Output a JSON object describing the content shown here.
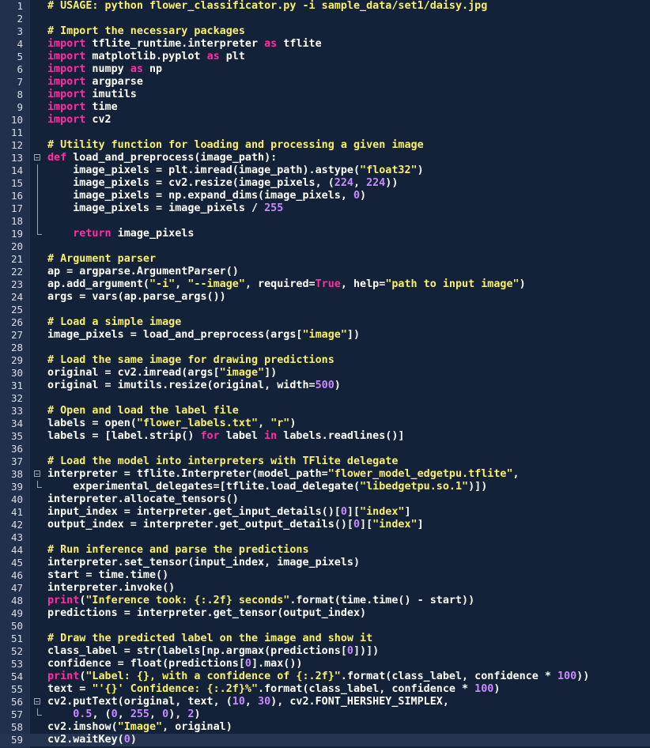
{
  "editor": {
    "colors": {
      "background": "#142239",
      "gutter": "#22314b",
      "current_line": "#25354f",
      "keyword": "#ff2fa3",
      "string": "#f9ef6a",
      "number": "#c78bff",
      "plain": "#ffffff"
    },
    "current_line": 59,
    "lines": [
      {
        "n": "1",
        "fold": "",
        "tokens": [
          {
            "t": "# USAGE: python flower_classificator.py -i sample_data/set1/daisy.jpg",
            "c": "com"
          }
        ]
      },
      {
        "n": "2",
        "fold": "",
        "tokens": []
      },
      {
        "n": "3",
        "fold": "",
        "tokens": [
          {
            "t": "# Import the necessary packages",
            "c": "com"
          }
        ]
      },
      {
        "n": "4",
        "fold": "",
        "tokens": [
          {
            "t": "import",
            "c": "kw"
          },
          {
            "t": " tflite_runtime.interpreter ",
            "c": "plain"
          },
          {
            "t": "as",
            "c": "kw"
          },
          {
            "t": " tflite",
            "c": "plain"
          }
        ]
      },
      {
        "n": "5",
        "fold": "",
        "tokens": [
          {
            "t": "import",
            "c": "kw"
          },
          {
            "t": " matplotlib.pyplot ",
            "c": "plain"
          },
          {
            "t": "as",
            "c": "kw"
          },
          {
            "t": " plt",
            "c": "plain"
          }
        ]
      },
      {
        "n": "6",
        "fold": "",
        "tokens": [
          {
            "t": "import",
            "c": "kw"
          },
          {
            "t": " numpy ",
            "c": "plain"
          },
          {
            "t": "as",
            "c": "kw"
          },
          {
            "t": " np",
            "c": "plain"
          }
        ]
      },
      {
        "n": "7",
        "fold": "",
        "tokens": [
          {
            "t": "import",
            "c": "kw"
          },
          {
            "t": " argparse",
            "c": "plain"
          }
        ]
      },
      {
        "n": "8",
        "fold": "",
        "tokens": [
          {
            "t": "import",
            "c": "kw"
          },
          {
            "t": " imutils",
            "c": "plain"
          }
        ]
      },
      {
        "n": "9",
        "fold": "",
        "tokens": [
          {
            "t": "import",
            "c": "kw"
          },
          {
            "t": " time",
            "c": "plain"
          }
        ]
      },
      {
        "n": "10",
        "fold": "",
        "tokens": [
          {
            "t": "import",
            "c": "kw"
          },
          {
            "t": " cv2",
            "c": "plain"
          }
        ]
      },
      {
        "n": "11",
        "fold": "",
        "tokens": []
      },
      {
        "n": "12",
        "fold": "",
        "tokens": [
          {
            "t": "# Utility function for loading and processing a given image",
            "c": "com"
          }
        ]
      },
      {
        "n": "13",
        "fold": "box",
        "tokens": [
          {
            "t": "def",
            "c": "kw"
          },
          {
            "t": " load_and_preprocess(image_path):",
            "c": "plain"
          }
        ]
      },
      {
        "n": "14",
        "fold": "bar",
        "tokens": [
          {
            "t": "    image_pixels = plt.imread(image_path).astype(",
            "c": "plain"
          },
          {
            "t": "\"float32\"",
            "c": "str"
          },
          {
            "t": ")",
            "c": "plain"
          }
        ]
      },
      {
        "n": "15",
        "fold": "bar",
        "tokens": [
          {
            "t": "    image_pixels = cv2.resize(image_pixels, (",
            "c": "plain"
          },
          {
            "t": "224",
            "c": "num"
          },
          {
            "t": ", ",
            "c": "plain"
          },
          {
            "t": "224",
            "c": "num"
          },
          {
            "t": "))",
            "c": "plain"
          }
        ]
      },
      {
        "n": "16",
        "fold": "bar",
        "tokens": [
          {
            "t": "    image_pixels = np.expand_dims(image_pixels, ",
            "c": "plain"
          },
          {
            "t": "0",
            "c": "num"
          },
          {
            "t": ")",
            "c": "plain"
          }
        ]
      },
      {
        "n": "17",
        "fold": "bar",
        "tokens": [
          {
            "t": "    image_pixels = image_pixels / ",
            "c": "plain"
          },
          {
            "t": "255",
            "c": "num"
          }
        ]
      },
      {
        "n": "18",
        "fold": "bar",
        "tokens": []
      },
      {
        "n": "19",
        "fold": "end",
        "tokens": [
          {
            "t": "    ",
            "c": "plain"
          },
          {
            "t": "return",
            "c": "kw"
          },
          {
            "t": " image_pixels",
            "c": "plain"
          }
        ]
      },
      {
        "n": "20",
        "fold": "",
        "tokens": []
      },
      {
        "n": "21",
        "fold": "",
        "tokens": [
          {
            "t": "# Argument parser",
            "c": "com"
          }
        ]
      },
      {
        "n": "22",
        "fold": "",
        "tokens": [
          {
            "t": "ap = argparse.ArgumentParser()",
            "c": "plain"
          }
        ]
      },
      {
        "n": "23",
        "fold": "",
        "tokens": [
          {
            "t": "ap.add_argument(",
            "c": "plain"
          },
          {
            "t": "\"-i\"",
            "c": "str"
          },
          {
            "t": ", ",
            "c": "plain"
          },
          {
            "t": "\"--image\"",
            "c": "str"
          },
          {
            "t": ", required=",
            "c": "plain"
          },
          {
            "t": "True",
            "c": "const"
          },
          {
            "t": ", help=",
            "c": "plain"
          },
          {
            "t": "\"path to input image\"",
            "c": "str"
          },
          {
            "t": ")",
            "c": "plain"
          }
        ]
      },
      {
        "n": "24",
        "fold": "",
        "tokens": [
          {
            "t": "args = vars(ap.parse_args())",
            "c": "plain"
          }
        ]
      },
      {
        "n": "25",
        "fold": "",
        "tokens": []
      },
      {
        "n": "26",
        "fold": "",
        "tokens": [
          {
            "t": "# Load a simple image",
            "c": "com"
          }
        ]
      },
      {
        "n": "27",
        "fold": "",
        "tokens": [
          {
            "t": "image_pixels = load_and_preprocess(args[",
            "c": "plain"
          },
          {
            "t": "\"image\"",
            "c": "str"
          },
          {
            "t": "])",
            "c": "plain"
          }
        ]
      },
      {
        "n": "28",
        "fold": "",
        "tokens": []
      },
      {
        "n": "29",
        "fold": "",
        "tokens": [
          {
            "t": "# Load the same image for drawing predictions",
            "c": "com"
          }
        ]
      },
      {
        "n": "30",
        "fold": "",
        "tokens": [
          {
            "t": "original = cv2.imread(args[",
            "c": "plain"
          },
          {
            "t": "\"image\"",
            "c": "str"
          },
          {
            "t": "])",
            "c": "plain"
          }
        ]
      },
      {
        "n": "31",
        "fold": "",
        "tokens": [
          {
            "t": "original = imutils.resize(original, width=",
            "c": "plain"
          },
          {
            "t": "500",
            "c": "num"
          },
          {
            "t": ")",
            "c": "plain"
          }
        ]
      },
      {
        "n": "32",
        "fold": "",
        "tokens": []
      },
      {
        "n": "33",
        "fold": "",
        "tokens": [
          {
            "t": "# Open and load the label file",
            "c": "com"
          }
        ]
      },
      {
        "n": "34",
        "fold": "",
        "tokens": [
          {
            "t": "labels = open(",
            "c": "plain"
          },
          {
            "t": "\"flower_labels.txt\"",
            "c": "str"
          },
          {
            "t": ", ",
            "c": "plain"
          },
          {
            "t": "\"r\"",
            "c": "str"
          },
          {
            "t": ")",
            "c": "plain"
          }
        ]
      },
      {
        "n": "35",
        "fold": "",
        "tokens": [
          {
            "t": "labels = [label.strip() ",
            "c": "plain"
          },
          {
            "t": "for",
            "c": "kw"
          },
          {
            "t": " label ",
            "c": "plain"
          },
          {
            "t": "in",
            "c": "kw"
          },
          {
            "t": " labels.readlines()]",
            "c": "plain"
          }
        ]
      },
      {
        "n": "36",
        "fold": "",
        "tokens": []
      },
      {
        "n": "37",
        "fold": "",
        "tokens": [
          {
            "t": "# Load the model into interpreters with TFlite delegate",
            "c": "com"
          }
        ]
      },
      {
        "n": "38",
        "fold": "box",
        "tokens": [
          {
            "t": "interpreter = tflite.Interpreter(model_path=",
            "c": "plain"
          },
          {
            "t": "\"flower_model_edgetpu.tflite\"",
            "c": "str"
          },
          {
            "t": ",",
            "c": "plain"
          }
        ]
      },
      {
        "n": "39",
        "fold": "end",
        "tokens": [
          {
            "t": "    experimental_delegates=[tflite.load_delegate(",
            "c": "plain"
          },
          {
            "t": "\"libedgetpu.so.1\"",
            "c": "str"
          },
          {
            "t": ")])",
            "c": "plain"
          }
        ]
      },
      {
        "n": "40",
        "fold": "",
        "tokens": [
          {
            "t": "interpreter.allocate_tensors()",
            "c": "plain"
          }
        ]
      },
      {
        "n": "41",
        "fold": "",
        "tokens": [
          {
            "t": "input_index = interpreter.get_input_details()[",
            "c": "plain"
          },
          {
            "t": "0",
            "c": "num"
          },
          {
            "t": "][",
            "c": "plain"
          },
          {
            "t": "\"index\"",
            "c": "str"
          },
          {
            "t": "]",
            "c": "plain"
          }
        ]
      },
      {
        "n": "42",
        "fold": "",
        "tokens": [
          {
            "t": "output_index = interpreter.get_output_details()[",
            "c": "plain"
          },
          {
            "t": "0",
            "c": "num"
          },
          {
            "t": "][",
            "c": "plain"
          },
          {
            "t": "\"index\"",
            "c": "str"
          },
          {
            "t": "]",
            "c": "plain"
          }
        ]
      },
      {
        "n": "43",
        "fold": "",
        "tokens": []
      },
      {
        "n": "44",
        "fold": "",
        "tokens": [
          {
            "t": "# Run inference and parse the predictions",
            "c": "com"
          }
        ]
      },
      {
        "n": "45",
        "fold": "",
        "tokens": [
          {
            "t": "interpreter.set_tensor(input_index, image_pixels)",
            "c": "plain"
          }
        ]
      },
      {
        "n": "46",
        "fold": "",
        "tokens": [
          {
            "t": "start = time.time()",
            "c": "plain"
          }
        ]
      },
      {
        "n": "47",
        "fold": "",
        "tokens": [
          {
            "t": "interpreter.invoke()",
            "c": "plain"
          }
        ]
      },
      {
        "n": "48",
        "fold": "",
        "tokens": [
          {
            "t": "print",
            "c": "kw"
          },
          {
            "t": "(",
            "c": "plain"
          },
          {
            "t": "\"Inference took: {:.2f} seconds\"",
            "c": "str"
          },
          {
            "t": ".format(time.time() - start))",
            "c": "plain"
          }
        ]
      },
      {
        "n": "49",
        "fold": "",
        "tokens": [
          {
            "t": "predictions = interpreter.get_tensor(output_index)",
            "c": "plain"
          }
        ]
      },
      {
        "n": "50",
        "fold": "",
        "tokens": []
      },
      {
        "n": "51",
        "fold": "",
        "tokens": [
          {
            "t": "# Draw the predicted label on the image and show it",
            "c": "com"
          }
        ]
      },
      {
        "n": "52",
        "fold": "",
        "tokens": [
          {
            "t": "class_label = str(labels[np.argmax(predictions[",
            "c": "plain"
          },
          {
            "t": "0",
            "c": "num"
          },
          {
            "t": "])])",
            "c": "plain"
          }
        ]
      },
      {
        "n": "53",
        "fold": "",
        "tokens": [
          {
            "t": "confidence = float(predictions[",
            "c": "plain"
          },
          {
            "t": "0",
            "c": "num"
          },
          {
            "t": "].max())",
            "c": "plain"
          }
        ]
      },
      {
        "n": "54",
        "fold": "",
        "tokens": [
          {
            "t": "print",
            "c": "kw"
          },
          {
            "t": "(",
            "c": "plain"
          },
          {
            "t": "\"Label: {}, with a confidence of {:.2f}\"",
            "c": "str"
          },
          {
            "t": ".format(class_label, confidence * ",
            "c": "plain"
          },
          {
            "t": "100",
            "c": "num"
          },
          {
            "t": "))",
            "c": "plain"
          }
        ]
      },
      {
        "n": "55",
        "fold": "",
        "tokens": [
          {
            "t": "text = ",
            "c": "plain"
          },
          {
            "t": "\"'{}' Confidence: {:.2f}%\"",
            "c": "str"
          },
          {
            "t": ".format(class_label, confidence * ",
            "c": "plain"
          },
          {
            "t": "100",
            "c": "num"
          },
          {
            "t": ")",
            "c": "plain"
          }
        ]
      },
      {
        "n": "56",
        "fold": "box",
        "tokens": [
          {
            "t": "cv2.putText(original, text, (",
            "c": "plain"
          },
          {
            "t": "10",
            "c": "num"
          },
          {
            "t": ", ",
            "c": "plain"
          },
          {
            "t": "30",
            "c": "num"
          },
          {
            "t": "), cv2.FONT_HERSHEY_SIMPLEX,",
            "c": "plain"
          }
        ]
      },
      {
        "n": "57",
        "fold": "end",
        "tokens": [
          {
            "t": "    ",
            "c": "plain"
          },
          {
            "t": "0.5",
            "c": "num"
          },
          {
            "t": ", (",
            "c": "plain"
          },
          {
            "t": "0",
            "c": "num"
          },
          {
            "t": ", ",
            "c": "plain"
          },
          {
            "t": "255",
            "c": "num"
          },
          {
            "t": ", ",
            "c": "plain"
          },
          {
            "t": "0",
            "c": "num"
          },
          {
            "t": "), ",
            "c": "plain"
          },
          {
            "t": "2",
            "c": "num"
          },
          {
            "t": ")",
            "c": "plain"
          }
        ]
      },
      {
        "n": "58",
        "fold": "",
        "tokens": [
          {
            "t": "cv2.imshow(",
            "c": "plain"
          },
          {
            "t": "\"Image\"",
            "c": "str"
          },
          {
            "t": ", original)",
            "c": "plain"
          }
        ]
      },
      {
        "n": "59",
        "fold": "",
        "tokens": [
          {
            "t": "cv2.waitKey(",
            "c": "plain"
          },
          {
            "t": "0",
            "c": "num"
          },
          {
            "t": ")",
            "c": "plain"
          }
        ]
      }
    ]
  }
}
